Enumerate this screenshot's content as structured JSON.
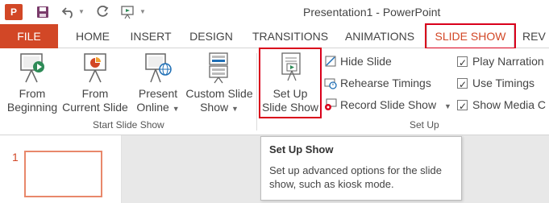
{
  "app": {
    "logo": "P",
    "window_title": "Presentation1 - PowerPoint"
  },
  "qat": {
    "save": "save-icon",
    "undo": "undo-icon",
    "redo": "redo-icon",
    "from_beginning": "start-slideshow-icon"
  },
  "tabs": [
    {
      "label": "FILE"
    },
    {
      "label": "HOME"
    },
    {
      "label": "INSERT"
    },
    {
      "label": "DESIGN"
    },
    {
      "label": "TRANSITIONS"
    },
    {
      "label": "ANIMATIONS"
    },
    {
      "label": "SLIDE SHOW"
    },
    {
      "label": "REV"
    }
  ],
  "ribbon": {
    "start_group": {
      "label": "Start Slide Show",
      "from_beginning": [
        "From",
        "Beginning"
      ],
      "from_current": [
        "From",
        "Current Slide"
      ],
      "present_online": [
        "Present",
        "Online"
      ],
      "custom_show": [
        "Custom Slide",
        "Show"
      ]
    },
    "setup_group": {
      "label": "Set Up",
      "setup_show": [
        "Set Up",
        "Slide Show"
      ],
      "hide_slide": "Hide Slide",
      "rehearse": "Rehearse Timings",
      "record": "Record Slide Show",
      "play_narrations": "Play Narration",
      "use_timings": "Use Timings",
      "show_media": "Show Media C"
    }
  },
  "slides": {
    "number": "1"
  },
  "tooltip": {
    "title": "Set Up Show",
    "body": "Set up advanced options for the slide show, such as kiosk mode."
  },
  "colors": {
    "accent": "#d24726",
    "highlight": "#d9001b"
  }
}
